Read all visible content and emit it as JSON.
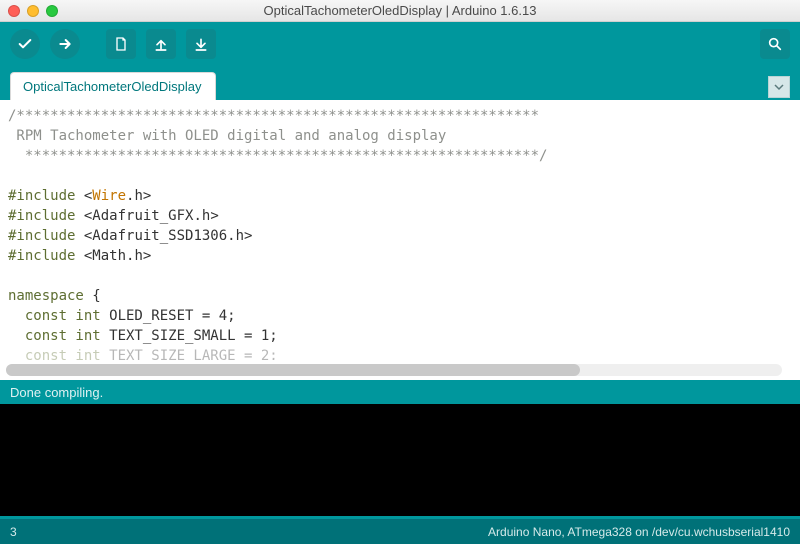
{
  "window": {
    "title": "OpticalTachometerOledDisplay | Arduino 1.6.13"
  },
  "tabs": {
    "active": "OpticalTachometerOledDisplay"
  },
  "toolbar": {
    "verify": "Verify",
    "upload": "Upload",
    "new": "New",
    "open": "Open",
    "save": "Save",
    "serial": "Serial Monitor"
  },
  "code": {
    "comment_top": "/**************************************************************",
    "comment_mid": " RPM Tachometer with OLED digital and analog display",
    "comment_end": "  *************************************************************/",
    "include": "#include",
    "inc1a": "Wire",
    "inc1b": ".h",
    "inc2": "Adafruit_GFX.h",
    "inc3": "Adafruit_SSD1306.h",
    "inc4": "Math.h",
    "ns": "namespace",
    "brace": " {",
    "ci": "const int",
    "l1": " OLED_RESET = 4;",
    "l2": " TEXT_SIZE_SMALL = 1;",
    "l3": " TEXT_SIZE_LARGE = 2;",
    "indent": "  "
  },
  "status": {
    "compile": "Done compiling."
  },
  "statusbar": {
    "line": "3",
    "board": "Arduino Nano, ATmega328 on /dev/cu.wchusbserial1410"
  }
}
